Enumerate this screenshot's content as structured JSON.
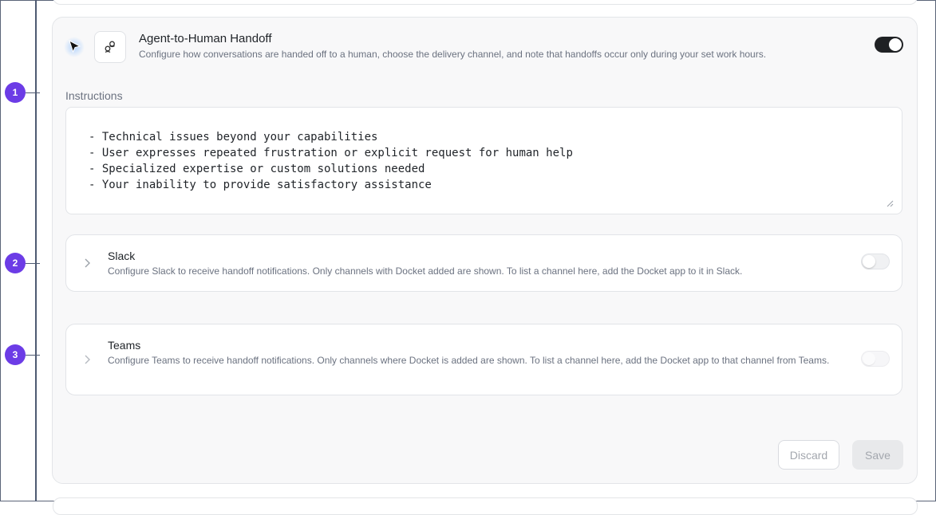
{
  "handoff": {
    "title": "Agent-to-Human Handoff",
    "subtitle": "Configure how conversations are handed off to a human, choose the delivery channel, and note that handoffs occur only during your set work hours.",
    "enabled": true,
    "icon": "handoff-icon"
  },
  "instructions": {
    "label": "Instructions",
    "lines": [
      "- Technical issues beyond your capabilities",
      "- User expresses repeated frustration or explicit request for human help",
      "- Specialized expertise or custom solutions needed",
      "- Your inability to provide satisfactory assistance"
    ]
  },
  "channels": [
    {
      "name": "Slack",
      "description": "Configure Slack to receive handoff notifications. Only channels with Docket added are shown. To list a channel here, add the Docket app to it in Slack.",
      "enabled": false
    },
    {
      "name": "Teams",
      "description": "Configure Teams to receive handoff notifications. Only channels where Docket is added are shown. To list a channel here, add the Docket app to that channel from Teams.",
      "enabled": false,
      "disabled": true
    }
  ],
  "markers": [
    "1",
    "2",
    "3"
  ],
  "actions": {
    "discard_label": "Discard",
    "save_label": "Save"
  },
  "colors": {
    "accent": "#6c3ce6",
    "toggle_on": "#1f2124",
    "guide_line": "#4e5a72"
  }
}
